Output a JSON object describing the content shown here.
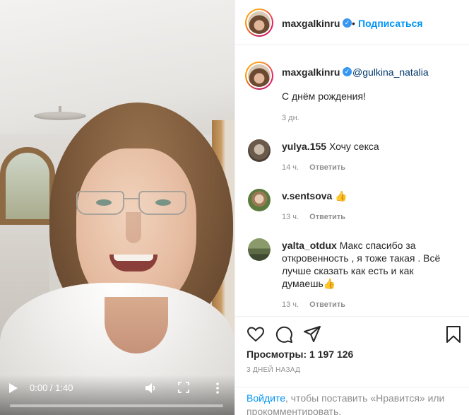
{
  "video": {
    "time": "0:00 / 1:40",
    "progress": 0.0
  },
  "header": {
    "username": "maxgalkinru",
    "separator": "•",
    "follow_label": "Подписаться"
  },
  "caption": {
    "username": "maxgalkinru",
    "mention": "@gulkina_natalia",
    "text": "С днём рождения!",
    "time": "3 дн."
  },
  "comments": [
    {
      "username": "yulya.155",
      "text": "Хочу секса",
      "time": "14 ч.",
      "reply": "Ответить"
    },
    {
      "username": "v.sentsova",
      "text": "👍",
      "time": "13 ч.",
      "reply": "Ответить"
    },
    {
      "username": "yalta_otdux",
      "text": "Макс спасибо за откровенность , я тоже такая . Всё лучше сказать как есть и как думаешь👍",
      "time": "13 ч.",
      "reply": "Ответить"
    }
  ],
  "actions": {
    "views": "Просмотры: 1 197 126",
    "ago": "3 ДНЕЙ НАЗАД",
    "login_link": "Войдите",
    "login_rest": ", чтобы поставить «Нравится» или прокомментировать."
  },
  "colors": {
    "link": "#0095f6",
    "verified": "#3897f0",
    "muted": "#8e8e8e",
    "text": "#262626"
  },
  "icons": [
    "play-icon",
    "volume-icon",
    "fullscreen-icon",
    "more-icon",
    "verified-icon",
    "heart-icon",
    "comment-icon",
    "share-icon",
    "bookmark-icon"
  ]
}
